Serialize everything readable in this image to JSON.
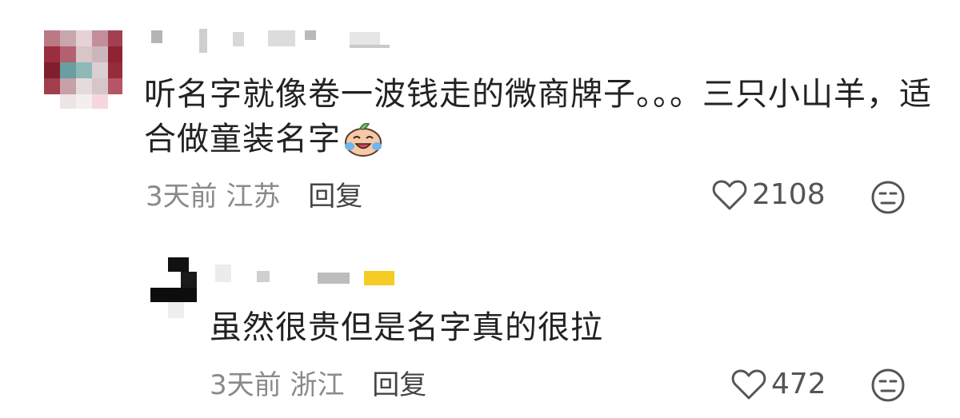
{
  "comments": [
    {
      "text": "听名字就像卷一波钱走的微商牌子。。。三只小山羊，适合做童装名字",
      "emoji": "crying-laughing-emoji",
      "time": "3天前",
      "location": "江苏",
      "reply_label": "回复",
      "likes": "2108"
    },
    {
      "text": "虽然很贵但是名字真的很拉",
      "time": "3天前",
      "location": "浙江",
      "reply_label": "回复",
      "likes": "472"
    }
  ],
  "icons": {
    "like": "heart-outline-icon",
    "dislike": "expressionless-face-icon"
  },
  "colors": {
    "text": "#222222",
    "meta": "#8a8a8a",
    "reply": "#444444",
    "icon": "#555555"
  }
}
